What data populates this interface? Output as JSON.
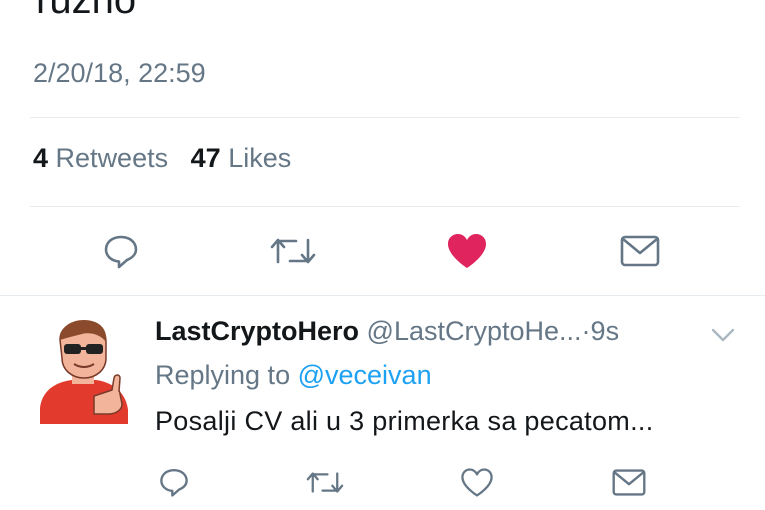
{
  "tweet": {
    "text_fragment": "ruzno",
    "timestamp": "2/20/18, 22:59",
    "retweets_count": "4",
    "retweets_label": "Retweets",
    "likes_count": "47",
    "likes_label": "Likes",
    "liked": true,
    "like_color": "#e0245e"
  },
  "reply": {
    "display_name": "LastCryptoHero",
    "handle": "@LastCryptoHe...",
    "separator": "·",
    "time": "9s",
    "replying_prefix": "Replying to",
    "replying_to": "@veceivan",
    "text": "Posalji CV ali u 3 primerka sa pecatom..."
  },
  "colors": {
    "text": "#14171a",
    "muted": "#657786",
    "link": "#1da1f2",
    "divider": "#e6ecf0"
  },
  "icons": [
    "reply-icon",
    "retweet-icon",
    "heart-icon",
    "message-icon",
    "chevron-down-icon"
  ]
}
